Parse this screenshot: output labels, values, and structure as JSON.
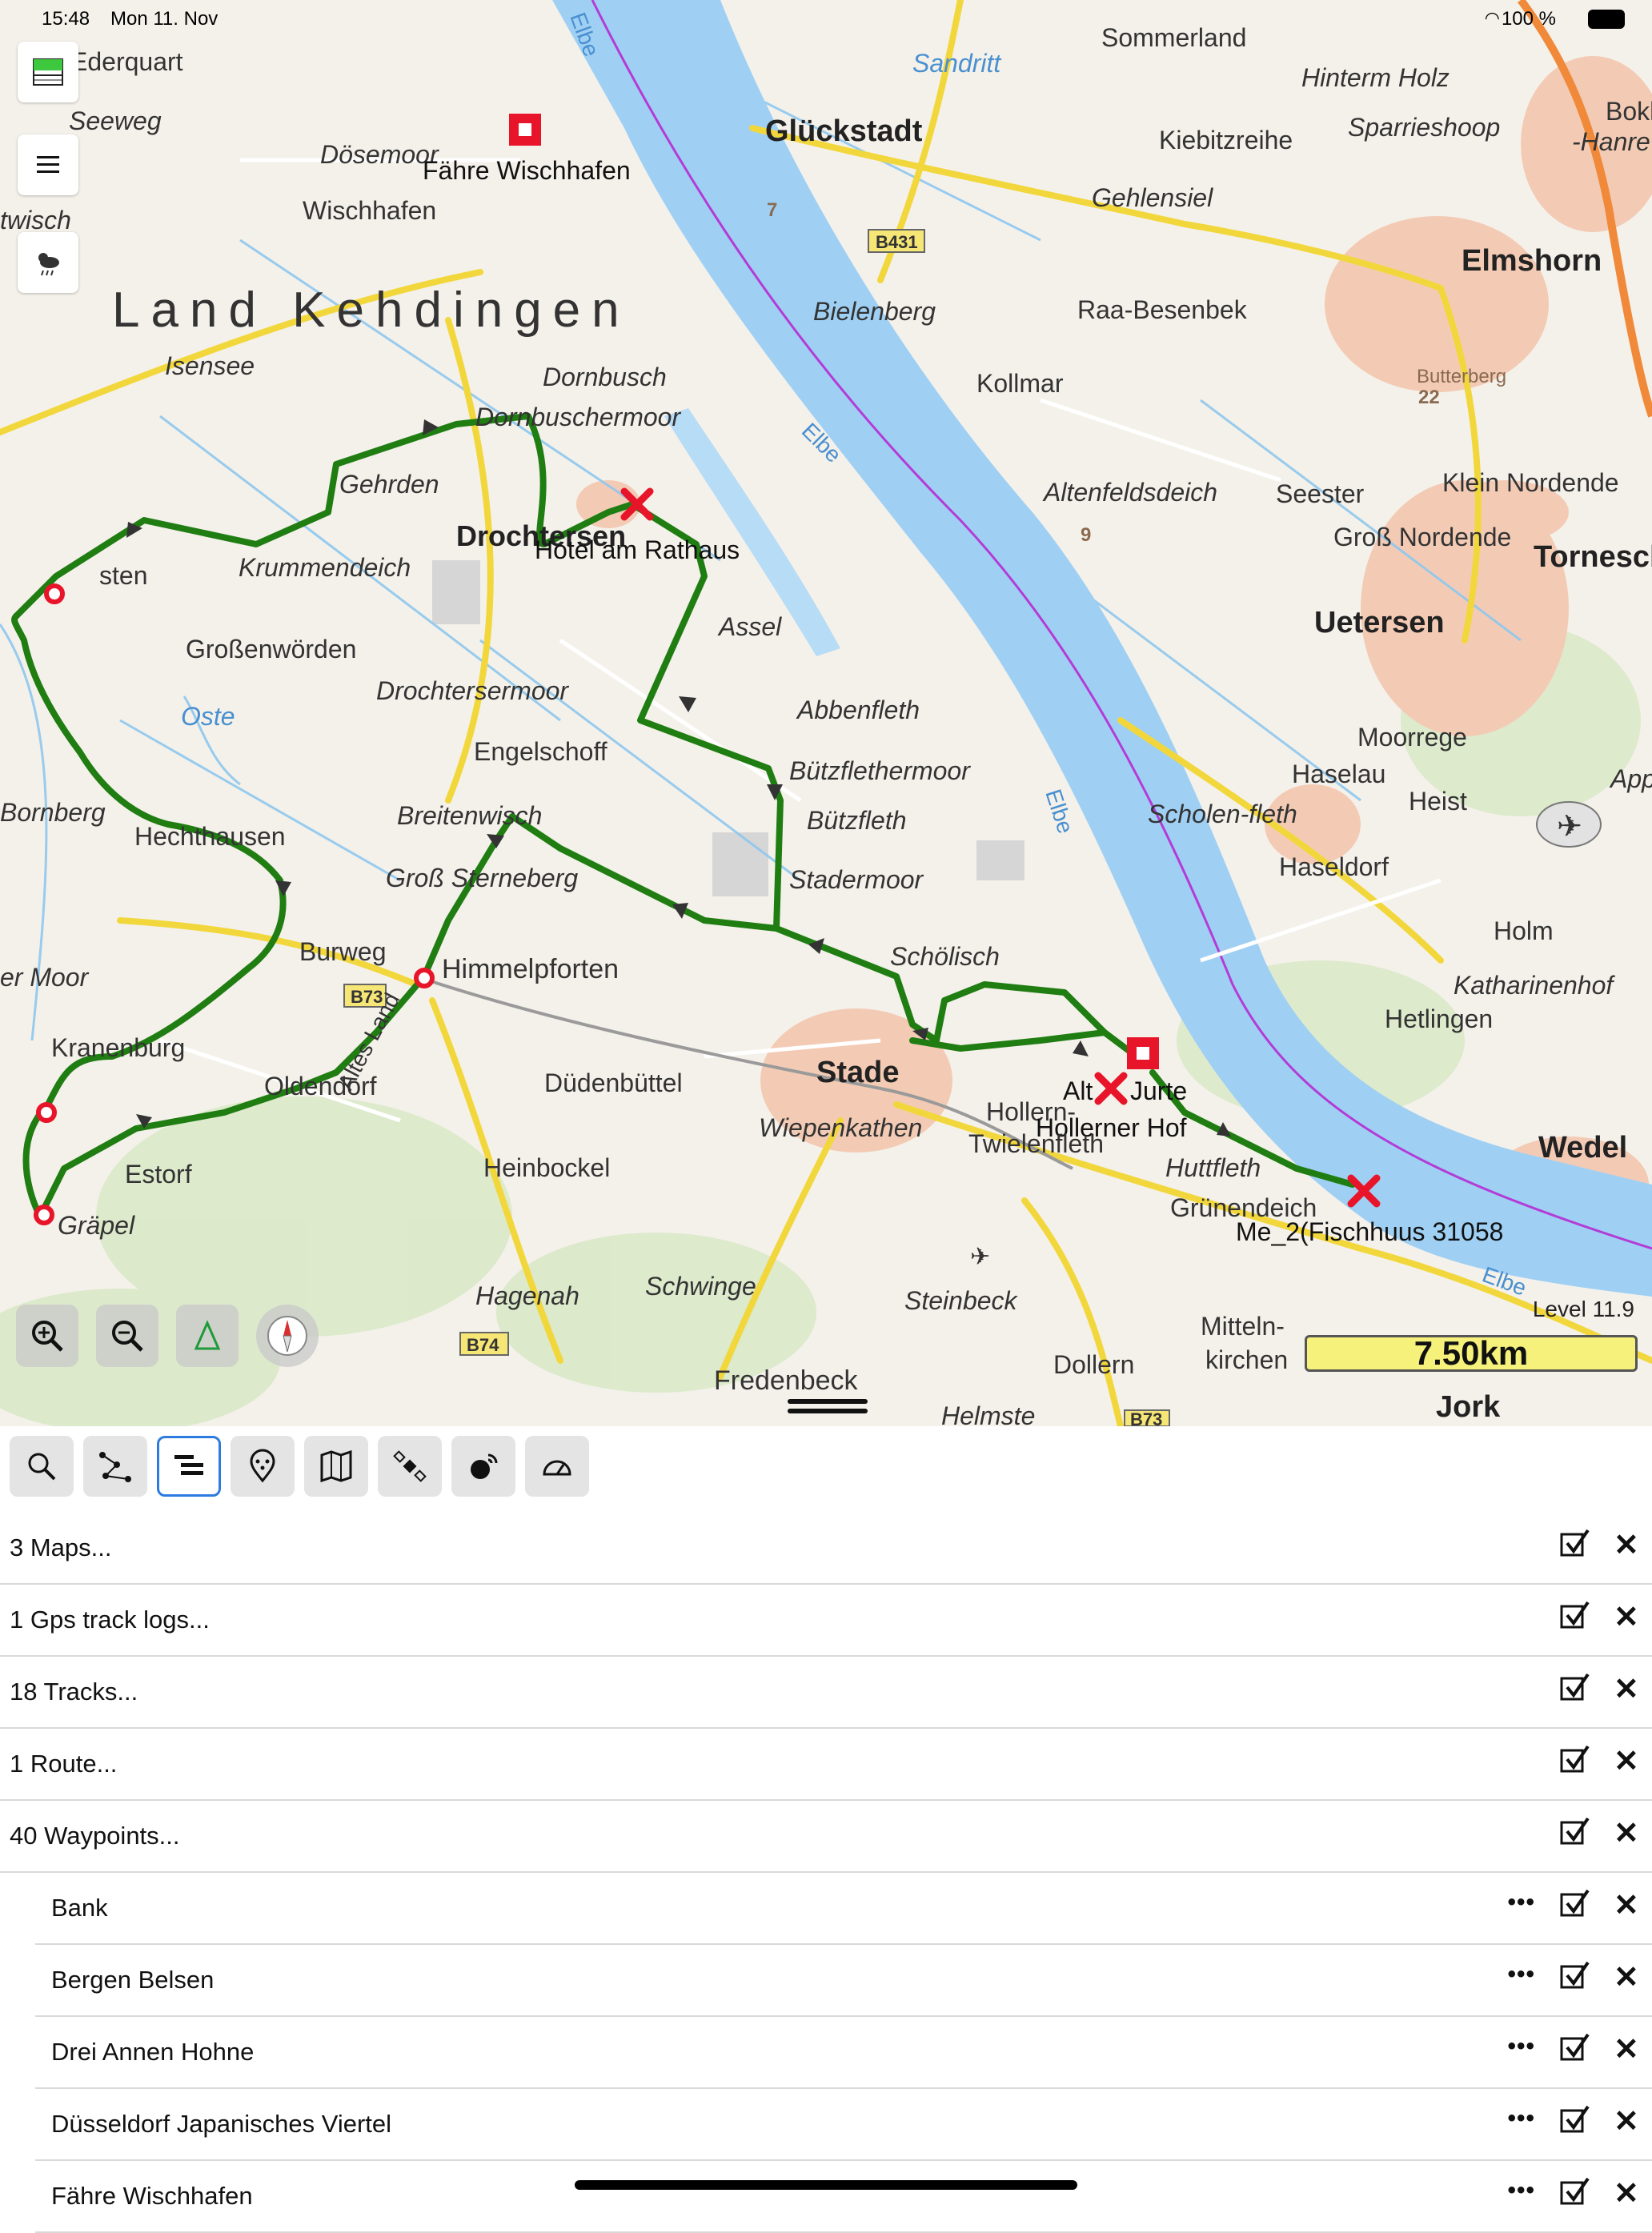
{
  "status_bar": {
    "time": "15:48",
    "date": "Mon 11. Nov",
    "battery": "100 %"
  },
  "map": {
    "level_label": "Level 11.9",
    "scale_label": "7.50km",
    "region_label": "Land Kehdingen",
    "places": [
      {
        "id": "ederquart",
        "text": "Ederquart"
      },
      {
        "id": "seeweg",
        "text": "Seeweg"
      },
      {
        "id": "dosemoor",
        "text": "Dösemoor"
      },
      {
        "id": "wischhafen",
        "text": "Wischhafen"
      },
      {
        "id": "twisch",
        "text": "twisch"
      },
      {
        "id": "faehre",
        "text": "Fähre Wischhafen"
      },
      {
        "id": "glueckstadt",
        "text": "Glückstadt"
      },
      {
        "id": "sandritt",
        "text": "Sandritt"
      },
      {
        "id": "sommerland",
        "text": "Sommerland"
      },
      {
        "id": "hinterm_holz",
        "text": "Hinterm Holz"
      },
      {
        "id": "sparrieshoop",
        "text": "Sparrieshoop"
      },
      {
        "id": "kiebitzreihe",
        "text": "Kiebitzreihe"
      },
      {
        "id": "bokh",
        "text": "Bokh"
      },
      {
        "id": "hanre",
        "text": "-Hanre"
      },
      {
        "id": "gehlensiel",
        "text": "Gehlensiel"
      },
      {
        "id": "elmshorn",
        "text": "Elmshorn"
      },
      {
        "id": "isensee",
        "text": "Isensee"
      },
      {
        "id": "bielenberg",
        "text": "Bielenberg"
      },
      {
        "id": "raa",
        "text": "Raa-Besenbek"
      },
      {
        "id": "dornbusch",
        "text": "Dornbusch"
      },
      {
        "id": "dornbuschermoor",
        "text": "Dornbuschermoor"
      },
      {
        "id": "kollmar",
        "text": "Kollmar"
      },
      {
        "id": "butterberg",
        "text": "Butterberg"
      },
      {
        "id": "gehrden",
        "text": "Gehrden"
      },
      {
        "id": "altenfeldsdeich",
        "text": "Altenfeldsdeich"
      },
      {
        "id": "seester",
        "text": "Seester"
      },
      {
        "id": "klein_nordende",
        "text": "Klein Nordende"
      },
      {
        "id": "drochtersen",
        "text": "Drochtersen"
      },
      {
        "id": "hotel",
        "text": "Hotel am Rathaus"
      },
      {
        "id": "gross_nordende",
        "text": "Groß Nordende"
      },
      {
        "id": "tornesch",
        "text": "Tornesch"
      },
      {
        "id": "sten",
        "text": "sten"
      },
      {
        "id": "krummendeich",
        "text": "Krummendeich"
      },
      {
        "id": "assel",
        "text": "Assel"
      },
      {
        "id": "uetersen",
        "text": "Uetersen"
      },
      {
        "id": "grossenwoerden",
        "text": "Großenwörden"
      },
      {
        "id": "drochtersermoor",
        "text": "Drochtersermoor"
      },
      {
        "id": "abbenfleth",
        "text": "Abbenfleth"
      },
      {
        "id": "oste",
        "text": "Oste"
      },
      {
        "id": "engelschoff",
        "text": "Engelschoff"
      },
      {
        "id": "moorrege",
        "text": "Moorrege"
      },
      {
        "id": "buetzflethermoor",
        "text": "Bützflethermoor"
      },
      {
        "id": "haselau",
        "text": "Haselau"
      },
      {
        "id": "appen",
        "text": "Appe"
      },
      {
        "id": "heist",
        "text": "Heist"
      },
      {
        "id": "bornberg",
        "text": "Bornberg"
      },
      {
        "id": "hechthausen",
        "text": "Hechthausen"
      },
      {
        "id": "breitenwisch",
        "text": "Breitenwisch"
      },
      {
        "id": "buetzfleth",
        "text": "Bützfleth"
      },
      {
        "id": "scholenfleth",
        "text": "Scholen-fleth"
      },
      {
        "id": "haseldorf",
        "text": "Haseldorf"
      },
      {
        "id": "gross_sterneberg",
        "text": "Groß Sterneberg"
      },
      {
        "id": "stadermoor",
        "text": "Stadermoor"
      },
      {
        "id": "holm",
        "text": "Holm"
      },
      {
        "id": "burweg",
        "text": "Burweg"
      },
      {
        "id": "himmelpforten",
        "text": "Himmelpforten"
      },
      {
        "id": "schoelisch",
        "text": "Schölisch"
      },
      {
        "id": "katharinenhof",
        "text": "Katharinenhof"
      },
      {
        "id": "er_moor",
        "text": "er Moor"
      },
      {
        "id": "hetlingen",
        "text": "Hetlingen"
      },
      {
        "id": "kranenburg",
        "text": "Kranenburg"
      },
      {
        "id": "altes_land",
        "text": "Altes Land"
      },
      {
        "id": "stade",
        "text": "Stade"
      },
      {
        "id": "oldendorf",
        "text": "Oldendorf"
      },
      {
        "id": "duedenbuettel",
        "text": "Düdenbüttel"
      },
      {
        "id": "alt",
        "text": "Alt"
      },
      {
        "id": "jurte",
        "text": "Jurte"
      },
      {
        "id": "hollern",
        "text": "Hollern-"
      },
      {
        "id": "hollerner_hof",
        "text": "Hollerner Hof"
      },
      {
        "id": "wiepenkathen",
        "text": "Wiepenkathen"
      },
      {
        "id": "twielenfleth",
        "text": "Twielenfleth"
      },
      {
        "id": "wedel",
        "text": "Wedel"
      },
      {
        "id": "estorf",
        "text": "Estorf"
      },
      {
        "id": "heinbockel",
        "text": "Heinbockel"
      },
      {
        "id": "huttfleth",
        "text": "Huttfleth"
      },
      {
        "id": "gruenendeich",
        "text": "Grünendeich"
      },
      {
        "id": "graepel",
        "text": "Gräpel"
      },
      {
        "id": "fischhuus",
        "text": "Me_2(Fischhuus 31058"
      },
      {
        "id": "hagenah",
        "text": "Hagenah"
      },
      {
        "id": "schwinge",
        "text": "Schwinge"
      },
      {
        "id": "steinbeck",
        "text": "Steinbeck"
      },
      {
        "id": "mitteln",
        "text": "Mitteln-"
      },
      {
        "id": "kirchen",
        "text": "kirchen"
      },
      {
        "id": "fredenbeck",
        "text": "Fredenbeck"
      },
      {
        "id": "dollern",
        "text": "Dollern"
      },
      {
        "id": "jork",
        "text": "Jork"
      },
      {
        "id": "helmste",
        "text": "Helmste"
      },
      {
        "id": "elbe1",
        "text": "Elbe"
      },
      {
        "id": "elbe2",
        "text": "Elbe"
      },
      {
        "id": "elbe3",
        "text": "Elbe"
      },
      {
        "id": "elbe4",
        "text": "Elbe"
      }
    ],
    "road_labels": [
      {
        "id": "b431",
        "text": "B431"
      },
      {
        "id": "b73a",
        "text": "B73"
      },
      {
        "id": "b74",
        "text": "B74"
      },
      {
        "id": "b73b",
        "text": "B73"
      },
      {
        "id": "r22",
        "text": "22"
      },
      {
        "id": "n7",
        "text": "7"
      },
      {
        "id": "n9",
        "text": "9"
      }
    ]
  },
  "toolbar": {
    "tools": [
      {
        "name": "search",
        "icon": "magnifier-icon"
      },
      {
        "name": "route",
        "icon": "route-icon"
      },
      {
        "name": "layers",
        "icon": "list-tree-icon",
        "active": true
      },
      {
        "name": "poi",
        "icon": "pin-icon"
      },
      {
        "name": "maps",
        "icon": "map-icon"
      },
      {
        "name": "gps",
        "icon": "satellite-icon"
      },
      {
        "name": "tracking",
        "icon": "tracking-icon"
      },
      {
        "name": "dashboard",
        "icon": "gauge-icon"
      }
    ]
  },
  "list": {
    "items": [
      {
        "label": "3 Maps...",
        "indent": false
      },
      {
        "label": "1 Gps track logs...",
        "indent": false
      },
      {
        "label": "18 Tracks...",
        "indent": false
      },
      {
        "label": "1 Route...",
        "indent": false
      },
      {
        "label": "40 Waypoints...",
        "indent": false
      },
      {
        "label": "Bank",
        "indent": true
      },
      {
        "label": "Bergen Belsen",
        "indent": true
      },
      {
        "label": "Drei Annen Hohne",
        "indent": true
      },
      {
        "label": "Düsseldorf Japanisches Viertel",
        "indent": true
      },
      {
        "label": "Fähre Wischhafen",
        "indent": true
      }
    ],
    "more_label": "•••",
    "close_label": "✕"
  },
  "colors": {
    "water": "#9fd0f4",
    "track": "#1f7d12",
    "road_yellow": "#f2d73c",
    "urban": "#f3cbb5",
    "accent": "#2d7be0",
    "waypoint_red": "#e8152a"
  }
}
